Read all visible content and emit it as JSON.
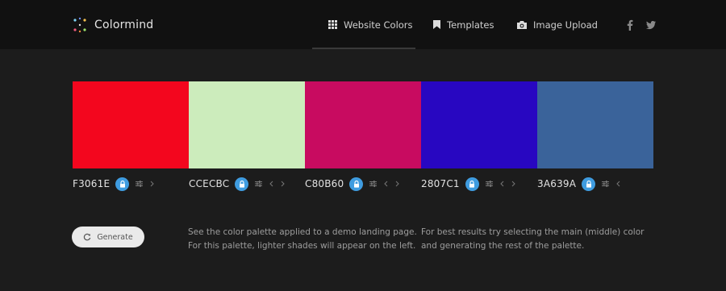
{
  "brand": {
    "name": "Colormind"
  },
  "nav": {
    "items": [
      {
        "label": "Website Colors",
        "icon": "grid-icon",
        "active": true
      },
      {
        "label": "Templates",
        "icon": "bookmark-icon",
        "active": false
      },
      {
        "label": "Image Upload",
        "icon": "camera-icon",
        "active": false
      }
    ],
    "social": [
      "facebook-icon",
      "twitter-icon"
    ]
  },
  "palette": [
    {
      "hex": "F3061E",
      "color": "#F3061E",
      "locked": true
    },
    {
      "hex": "CCECBC",
      "color": "#CCECBC",
      "locked": true
    },
    {
      "hex": "C80B60",
      "color": "#C80B60",
      "locked": true
    },
    {
      "hex": "2807C1",
      "color": "#2807C1",
      "locked": true
    },
    {
      "hex": "3A639A",
      "color": "#3A639A",
      "locked": true
    }
  ],
  "generate": {
    "label": "Generate",
    "icon": "refresh-icon"
  },
  "info": {
    "demo_line1": "See the color palette applied to a demo landing page.",
    "demo_line2": "For this palette, lighter shades will appear on the left.",
    "tip_line1": "For best results try selecting the main (middle) color",
    "tip_line2": "and generating the rest of the palette."
  },
  "colors": {
    "topbar": "#111111",
    "background": "#1c1c1c",
    "lock_accent": "#3f9ce0",
    "button_bg": "#eaeaea"
  }
}
